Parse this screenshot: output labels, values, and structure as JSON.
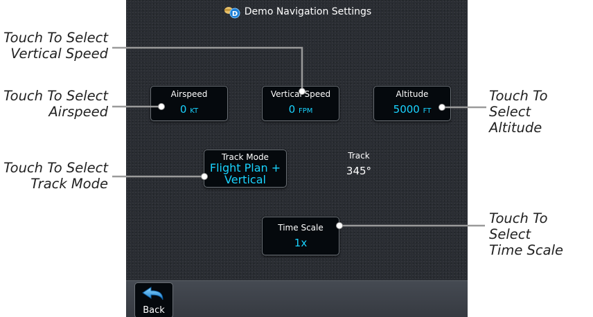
{
  "title": "Demo Navigation Settings",
  "airspeed": {
    "label": "Airspeed",
    "value": "0",
    "unit": "KT"
  },
  "vertical_speed": {
    "label": "Vertical Speed",
    "value": "0",
    "unit": "FPM"
  },
  "altitude": {
    "label": "Altitude",
    "value": "5000",
    "unit": "FT"
  },
  "track_mode": {
    "label": "Track Mode",
    "value_line1": "Flight Plan +",
    "value_line2": "Vertical"
  },
  "track": {
    "label": "Track",
    "value": "345°"
  },
  "time_scale": {
    "label": "Time Scale",
    "value": "1x"
  },
  "back_label": "Back",
  "callouts": {
    "vertical_speed": [
      "Touch To Select",
      "Vertical Speed"
    ],
    "airspeed": [
      "Touch To Select",
      "Airspeed"
    ],
    "track_mode": [
      "Touch To Select",
      "Track Mode"
    ],
    "altitude": [
      "Touch To Select",
      "Altitude"
    ],
    "time_scale": [
      "Touch To Select",
      "Time Scale"
    ]
  },
  "colors": {
    "value_text": "#19d3ff",
    "background": "#2a2d33",
    "button": "#05090d"
  },
  "icons": {
    "title": "demo-navigation-icon",
    "back": "back-arrow-icon"
  }
}
